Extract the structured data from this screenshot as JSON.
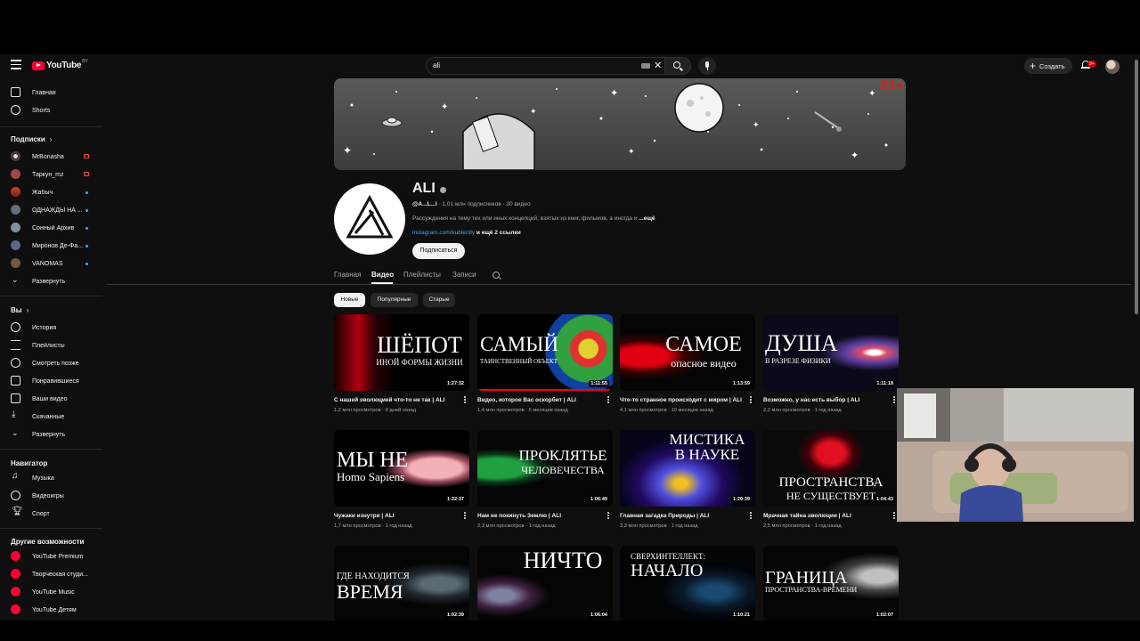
{
  "topbar": {
    "logo_text": "YouTube",
    "region": "BY",
    "search_value": "ali",
    "create_label": "Создать",
    "notif_count": "9+"
  },
  "sidebar": {
    "main": [
      {
        "label": "Главная",
        "icon": "home-icon"
      },
      {
        "label": "Shorts",
        "icon": "shorts-icon"
      }
    ],
    "subscriptions_header": "Подписки",
    "subscriptions": [
      {
        "label": "MrBonasha",
        "indicator": "live"
      },
      {
        "label": "Таркун_mz",
        "indicator": "live"
      },
      {
        "label": "Жабыч",
        "indicator": "dot"
      },
      {
        "label": "ОДНАЖДЫ НА ...",
        "indicator": "dot"
      },
      {
        "label": "Сонный Архив",
        "indicator": "dot"
      },
      {
        "label": "Миронов Де-Фа...",
        "indicator": "dot"
      },
      {
        "label": "VANOMAS",
        "indicator": "dot"
      }
    ],
    "subs_expand": "Развернуть",
    "you_header": "Вы",
    "you": [
      {
        "label": "История",
        "icon": "history-icon"
      },
      {
        "label": "Плейлисты",
        "icon": "playlists-icon"
      },
      {
        "label": "Смотреть позже",
        "icon": "watch-later-icon"
      },
      {
        "label": "Понравившиеся",
        "icon": "like-icon"
      },
      {
        "label": "Ваши видео",
        "icon": "your-videos-icon"
      },
      {
        "label": "Скачанные",
        "icon": "download-icon"
      }
    ],
    "you_expand": "Развернуть",
    "navigator_header": "Навигатор",
    "navigator": [
      {
        "label": "Музыка",
        "icon": "music-icon"
      },
      {
        "label": "Видеоигры",
        "icon": "gaming-icon"
      },
      {
        "label": "Спорт",
        "icon": "trophy-icon"
      }
    ],
    "more_header": "Другие возможности",
    "more": [
      {
        "label": "YouTube Premium"
      },
      {
        "label": "Творческая студи..."
      },
      {
        "label": "YouTube Music"
      },
      {
        "label": "YouTube Детям"
      }
    ]
  },
  "channel": {
    "banner_badge": "21+",
    "name": "ALI",
    "handle": "@A...L...I",
    "stats": " · 1,01 млн подписчиков · 30 видео",
    "description": "Рассуждения на тему тех или иных концепций, взятых из книг, фильмов, а иногда и",
    "description_more": "...ещё",
    "link": "instagram.com/kublently",
    "links_more": " и ещё 2 ссылки",
    "subscribe_label": "Подписаться"
  },
  "tabs": [
    "Главная",
    "Видео",
    "Плейлисты",
    "Записи"
  ],
  "active_tab": "Видео",
  "chips": [
    "Новые",
    "Популярные",
    "Старые"
  ],
  "videos": [
    {
      "thumb_line1": "ШЁПОТ",
      "thumb_line2": "ИНОЙ ФОРМЫ ЖИЗНИ",
      "duration": "1:27:32",
      "title": "С нашей эволюцией что-то не так | ALI",
      "meta": "1,2 млн просмотров · 9 дней назад"
    },
    {
      "thumb_line1": "САМЫЙ",
      "thumb_line2": "ТАИНСТВЕННЫЙ ОБЪЕКТ",
      "duration": "1:11:55",
      "title": "Видео, которое Вас оскорбит | ALI",
      "meta": "1,4 млн просмотров · 6 месяцев назад",
      "progress": 0.98
    },
    {
      "thumb_line1": "САМОЕ",
      "thumb_line2": "опасное видео",
      "duration": "1:13:59",
      "title": "Что-то странное происходит с миром | ALI",
      "meta": "4,1 млн просмотров · 10 месяцев назад"
    },
    {
      "thumb_line1": "ДУША",
      "thumb_line2": "В РАЗРЕЗЕ ФИЗИКИ",
      "duration": "1:11:18",
      "title": "Возможно, у нас есть выбор | ALI",
      "meta": "2,2 млн просмотров · 1 год назад"
    },
    {
      "thumb_line1": "МЫ НЕ",
      "thumb_line2": "Homo Sapiens",
      "duration": "1:32:37",
      "title": "Чужаки изнутри | ALI",
      "meta": "1,7 млн просмотров · 1 год назад"
    },
    {
      "thumb_line1": "ПРОКЛЯТЬЕ",
      "thumb_line2": "ЧЕЛОВЕЧЕСТВА",
      "duration": "1:06:49",
      "title": "Нам не покинуть Землю | ALI",
      "meta": "2,3 млн просмотров · 1 год назад"
    },
    {
      "thumb_line1": "МИСТИКА",
      "thumb_line2": "В НАУКЕ",
      "duration": "1:20:39",
      "title": "Главная загадка Природы | ALI",
      "meta": "3,3 млн просмотров · 1 год назад"
    },
    {
      "thumb_line1": "ПРОСТРАНСТВА",
      "thumb_line2": "НЕ СУЩЕСТВУЕТ",
      "duration": "1:04:43",
      "title": "Мрачная тайна эволюции | ALI",
      "meta": "2,5 млн просмотров · 1 год назад"
    },
    {
      "thumb_line1": "ГДЕ НАХОДИТСЯ",
      "thumb_line2": "ВРЕМЯ",
      "duration": "1:02:39",
      "title": "",
      "meta": ""
    },
    {
      "thumb_line1": "НИЧТО",
      "thumb_line2": "",
      "duration": "1:06:04",
      "title": "",
      "meta": ""
    },
    {
      "thumb_line1": "СВЕРХИНТЕЛЛЕКТ:",
      "thumb_line2": "НАЧАЛО",
      "duration": "1:10:21",
      "title": "",
      "meta": ""
    },
    {
      "thumb_line1": "ГРАНИЦА",
      "thumb_line2": "ПРОСТРАНСТВА-ВРЕМЕНИ",
      "duration": "1:02:07",
      "title": "",
      "meta": ""
    }
  ],
  "colors": {
    "background": "#0f0f0f",
    "accent_red": "#ff0033",
    "link_blue": "#3ea6ff",
    "age_badge": "#e01b1b"
  }
}
